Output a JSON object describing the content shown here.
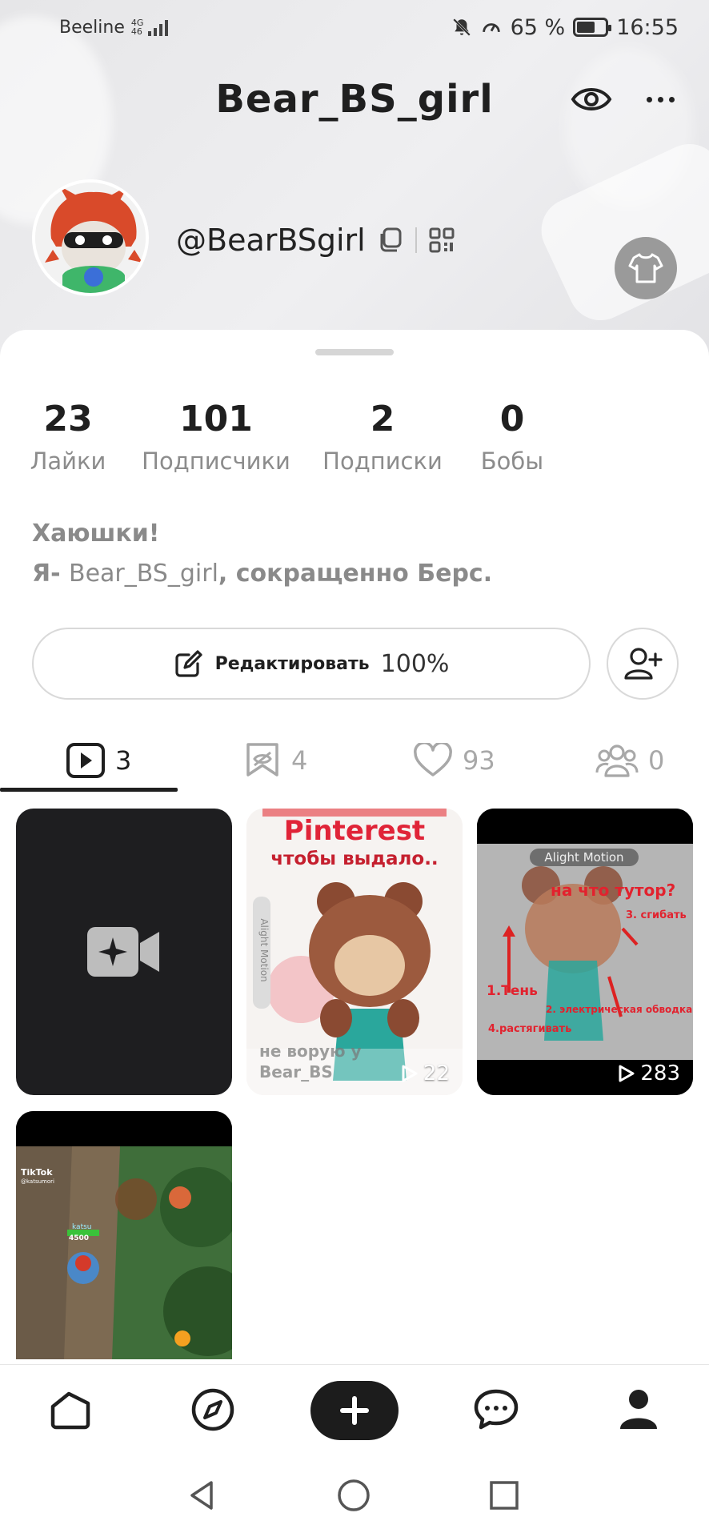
{
  "status_bar": {
    "carrier": "Beeline",
    "network_top": "4G",
    "network_bottom": "46",
    "battery_percent": "65 %",
    "battery_level": 0.65,
    "time": "16:55"
  },
  "header": {
    "title": "Bear_BS_girl",
    "handle": "@BearBSgirl"
  },
  "stats": [
    {
      "value": "23",
      "label": "Лайки"
    },
    {
      "value": "101",
      "label": "Подписчики"
    },
    {
      "value": "2",
      "label": "Подписки"
    },
    {
      "value": "0",
      "label": "Бобы"
    }
  ],
  "bio": {
    "line1": "Хаюшки!",
    "line2_prefix": "Я- ",
    "line2_name": "Bear_BS_girl",
    "line2_suffix": ", сокращенно Берс."
  },
  "edit_button": {
    "label": "Редактировать",
    "percent": "100%"
  },
  "tabs": [
    {
      "name": "videos",
      "count": "3",
      "active": true
    },
    {
      "name": "saved",
      "count": "4",
      "active": false
    },
    {
      "name": "liked",
      "count": "93",
      "active": false
    },
    {
      "name": "collabs",
      "count": "0",
      "active": false
    }
  ],
  "videos": [
    {
      "kind": "create",
      "views": ""
    },
    {
      "kind": "video",
      "views": "22",
      "overlay_top": "Pinterest",
      "overlay_sub": "чтобы выдало..",
      "overlay_bottom": "не ворую у",
      "overlay_bottom2": "Bear_BS",
      "watermark": "Alight Motion"
    },
    {
      "kind": "video",
      "views": "283",
      "watermark": "Alight Motion",
      "overlay_q": "на что тутор?",
      "labels": [
        "1.Тень",
        "2. электрическая обводка",
        "3. сгибать",
        "4.растягивать"
      ]
    },
    {
      "kind": "video",
      "views": "",
      "watermark": "TikTok",
      "watermark_user": "@katsumori",
      "game_label": "katsu",
      "game_score": "4500"
    }
  ],
  "colors": {
    "accent": "#1f1f1f",
    "muted": "#8c8c8c",
    "tab_inactive": "#a8a8a8",
    "sheet": "#ffffff",
    "header_bg": "#ebebeb"
  }
}
